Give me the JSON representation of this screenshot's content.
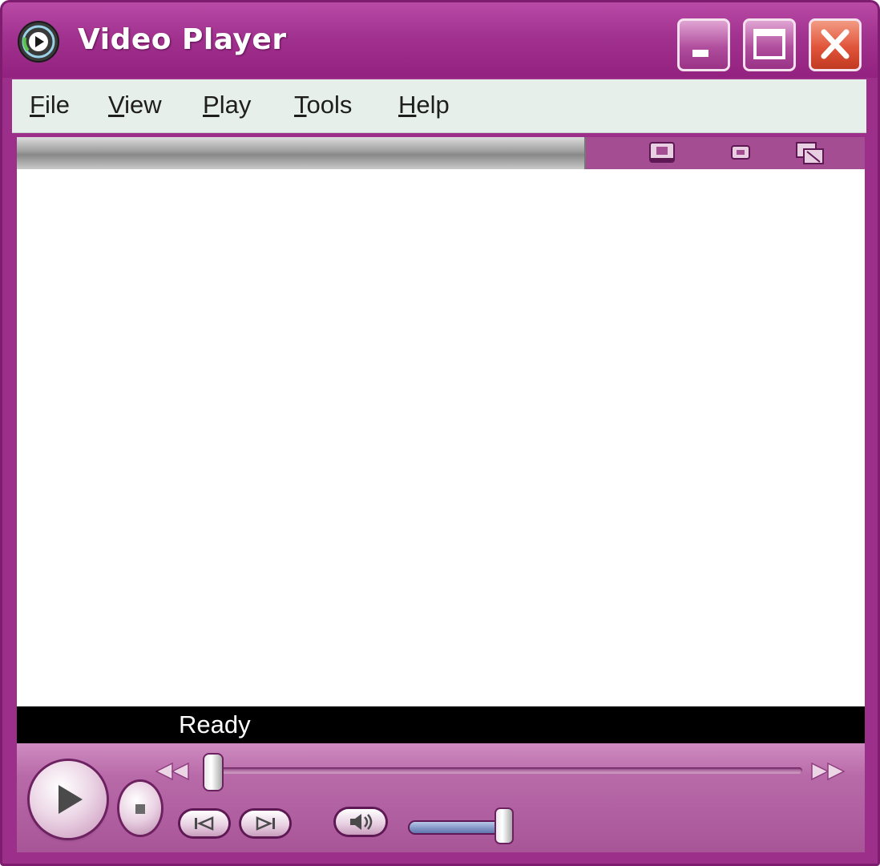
{
  "window": {
    "title": "Video Player",
    "icons": {
      "app": "media-player-icon",
      "minimize": "minimize-icon",
      "maximize": "maximize-icon",
      "close": "close-icon"
    }
  },
  "menu": {
    "items": [
      {
        "label": "File",
        "accel": "F",
        "rest": "ile"
      },
      {
        "label": "View",
        "accel": "V",
        "rest": "iew"
      },
      {
        "label": "Play",
        "accel": "P",
        "rest": "lay"
      },
      {
        "label": "Tools",
        "accel": "T",
        "rest": "ools"
      },
      {
        "label": "Help",
        "accel": "H",
        "rest": "elp"
      }
    ]
  },
  "toolstrip": {
    "icons": [
      "compact-mode-icon",
      "minimize-to-tray-icon",
      "full-screen-icon"
    ]
  },
  "status": {
    "text": "Ready"
  },
  "controls": {
    "icons": [
      "play-icon",
      "stop-icon",
      "rewind-icon",
      "fast-forward-icon",
      "previous-icon",
      "next-icon",
      "mute-icon"
    ],
    "seek_position": 0.0,
    "volume_level": 1.0
  },
  "colors": {
    "frame": "#9c2f8a",
    "menubar": "#e6efe9",
    "close_button": "#e0553a",
    "status_bg": "#000000"
  }
}
